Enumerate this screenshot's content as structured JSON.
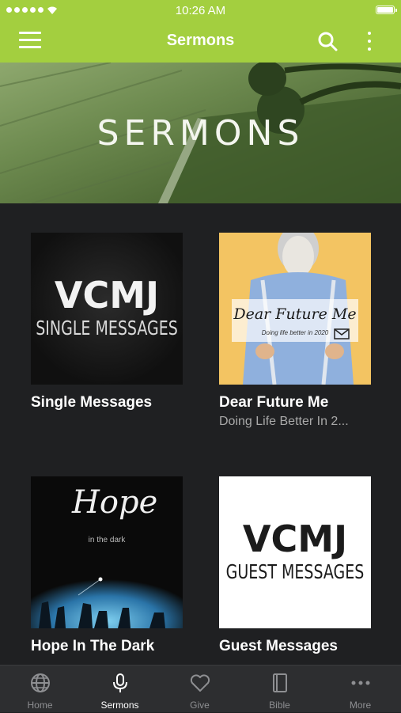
{
  "status_bar": {
    "time": "10:26 AM"
  },
  "nav": {
    "title": "Sermons"
  },
  "banner": {
    "title": "SERMONS"
  },
  "series": [
    {
      "title": "Single Messages",
      "subtitle": "",
      "logo_main": "VCMJ",
      "logo_sub": "SINGLE MESSAGES"
    },
    {
      "title": "Dear Future Me",
      "subtitle": "Doing Life Better In 2...",
      "art_text": "Dear Future Me",
      "art_sub": "Doing life better in 2020"
    },
    {
      "title": "Hope In The Dark",
      "subtitle": "",
      "art_text": "Hope",
      "art_sub": "in the dark"
    },
    {
      "title": "Guest Messages",
      "subtitle": "",
      "logo_main": "VCMJ",
      "logo_sub": "GUEST MESSAGES"
    }
  ],
  "tabs": [
    {
      "label": "Home",
      "icon": "globe-icon"
    },
    {
      "label": "Sermons",
      "icon": "microphone-icon"
    },
    {
      "label": "Give",
      "icon": "heart-icon"
    },
    {
      "label": "Bible",
      "icon": "book-icon"
    },
    {
      "label": "More",
      "icon": "more-icon"
    }
  ],
  "colors": {
    "accent": "#a3cf3f",
    "background": "#1f2022",
    "tabbar": "#2d2e30"
  }
}
